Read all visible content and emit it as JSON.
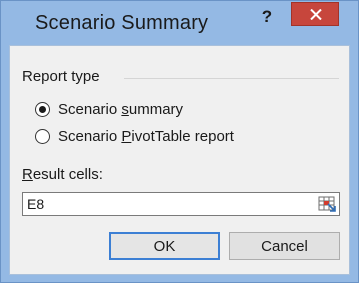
{
  "window": {
    "title": "Scenario Summary",
    "help_label": "?",
    "close_icon": "close-icon"
  },
  "report_type": {
    "label": "Report type",
    "options": [
      {
        "prefix": "Scenario ",
        "mnemonic": "s",
        "suffix": "ummary",
        "checked": true
      },
      {
        "prefix": "Scenario ",
        "mnemonic": "P",
        "suffix": "ivotTable report",
        "checked": false
      }
    ]
  },
  "result_cells": {
    "label_mnemonic": "R",
    "label_rest": "esult cells:",
    "value": "E8",
    "picker_icon": "range-selector-icon"
  },
  "buttons": {
    "ok": "OK",
    "cancel": "Cancel"
  },
  "colors": {
    "frame": "#94b9e4",
    "client": "#f0f0f0",
    "close": "#c7463c",
    "default_button_border": "#3c7fd4"
  }
}
